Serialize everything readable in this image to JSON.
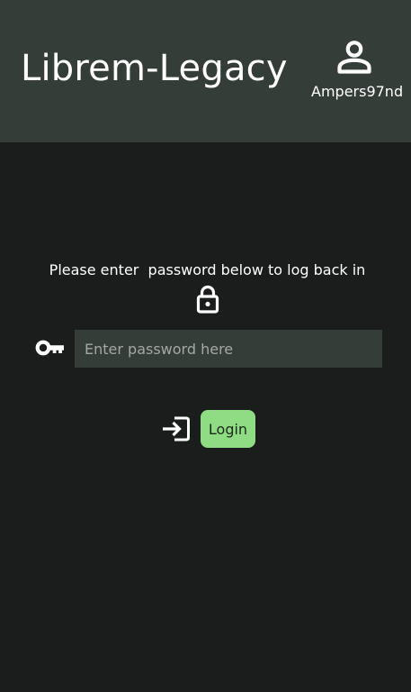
{
  "header": {
    "app_title": "Librem-Legacy",
    "user": {
      "icon": "person-icon",
      "username": "Ampers97nd"
    }
  },
  "main": {
    "prompt": "Please enter  password below to log back in",
    "lock_icon": "lock-icon",
    "password": {
      "icon": "key-icon",
      "value": "",
      "placeholder": "Enter password here"
    },
    "login": {
      "icon": "login-icon",
      "label": "Login"
    }
  },
  "colors": {
    "background": "#1b1d1c",
    "header_background": "#353d39",
    "input_background": "#353d39",
    "text": "#ffffff",
    "placeholder": "#a3a8a6",
    "login_button": "#8fdc84"
  }
}
